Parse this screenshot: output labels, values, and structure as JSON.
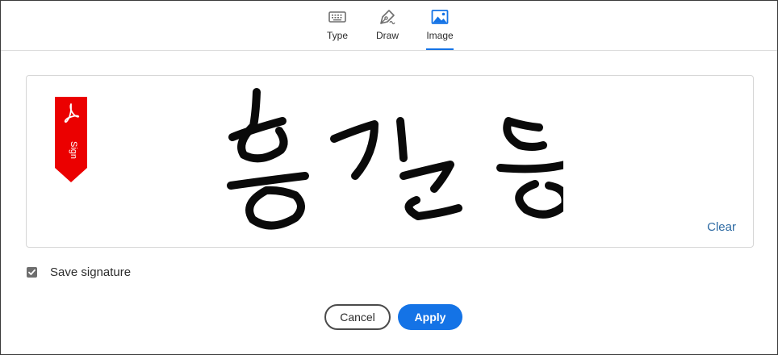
{
  "tabs": [
    {
      "label": "Type",
      "icon": "keyboard-icon",
      "active": false
    },
    {
      "label": "Draw",
      "icon": "pen-icon",
      "active": false
    },
    {
      "label": "Image",
      "icon": "image-icon",
      "active": true
    }
  ],
  "signature_area": {
    "badge_text": "Sign",
    "clear_label": "Clear"
  },
  "save_signature": {
    "label": "Save signature",
    "checked": true
  },
  "buttons": {
    "cancel": "Cancel",
    "apply": "Apply"
  },
  "colors": {
    "accent": "#1473e6",
    "badge_red": "#eb0000",
    "link": "#2d6aa3"
  }
}
